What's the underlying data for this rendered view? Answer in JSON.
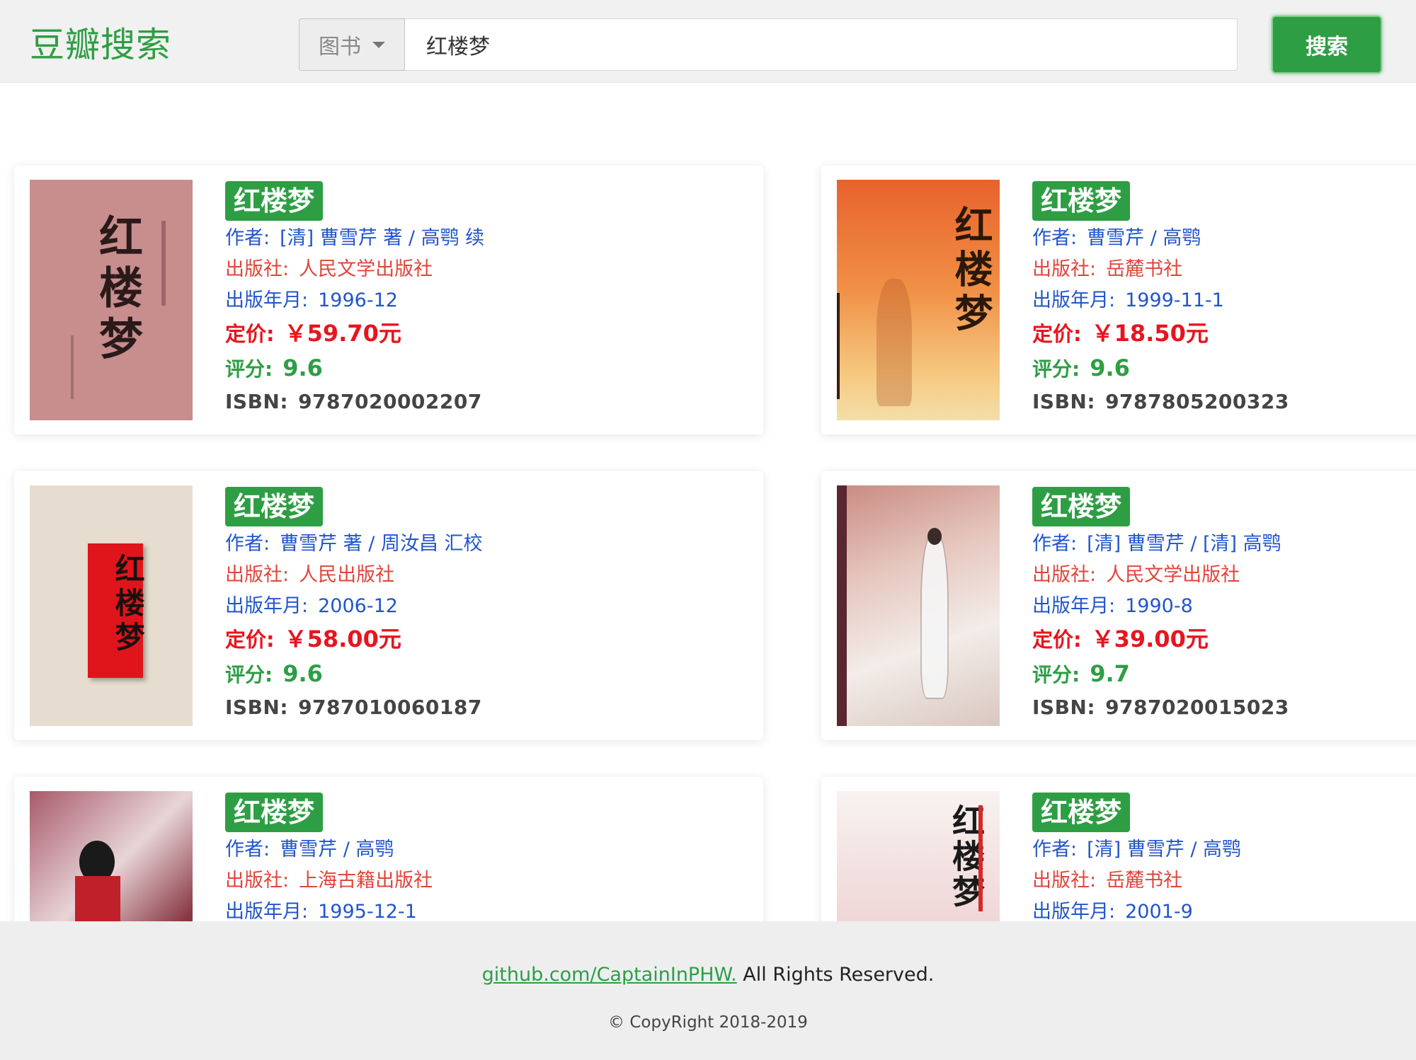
{
  "header": {
    "logo": "豆瓣搜索",
    "category": "图书",
    "query": "红楼梦",
    "search_button": "搜索"
  },
  "labels": {
    "author": "作者:",
    "publisher": "出版社:",
    "pubdate": "出版年月:",
    "price": "定价:",
    "rating": "评分:",
    "isbn": "ISBN:"
  },
  "books": [
    {
      "title": "红楼梦",
      "author": "[清] 曹雪芹 著 / 高鹗 续",
      "publisher": "人民文学出版社",
      "pubdate": "1996-12",
      "price": "￥59.70元",
      "rating": "9.6",
      "isbn": "9787020002207",
      "cover_text": "红楼梦"
    },
    {
      "title": "红楼梦",
      "author": "曹雪芹 / 高鹗",
      "publisher": "岳麓书社",
      "pubdate": "1999-11-1",
      "price": "￥18.50元",
      "rating": "9.6",
      "isbn": "9787805200323",
      "cover_text": "红楼梦"
    },
    {
      "title": "红楼梦",
      "author": "曹雪芹 著 / 周汝昌 汇校",
      "publisher": "人民出版社",
      "pubdate": "2006-12",
      "price": "￥58.00元",
      "rating": "9.6",
      "isbn": "9787010060187",
      "cover_text": "红楼梦"
    },
    {
      "title": "红楼梦",
      "author": "[清] 曹雪芹 / [清] 高鹗",
      "publisher": "人民文学出版社",
      "pubdate": "1990-8",
      "price": "￥39.00元",
      "rating": "9.7",
      "isbn": "9787020015023",
      "cover_text": ""
    },
    {
      "title": "红楼梦",
      "author": "曹雪芹 / 高鹗",
      "publisher": "上海古籍出版社",
      "pubdate": "1995-12-1",
      "price": "",
      "rating": "",
      "isbn": "",
      "cover_text": ""
    },
    {
      "title": "红楼梦",
      "author": "[清] 曹雪芹 / 高鹗",
      "publisher": "岳麓书社",
      "pubdate": "2001-9",
      "price": "",
      "rating": "",
      "isbn": "",
      "cover_text": "红楼梦"
    }
  ],
  "footer": {
    "link": "github.com/CaptainInPHW.",
    "rights": " All Rights Reserved.",
    "copyright": "© CopyRight 2018-2019"
  },
  "colors": {
    "brand_green": "#2e9e44",
    "price_red": "#e8141e",
    "author_blue": "#2255cc",
    "publisher_red": "#e0453a"
  }
}
